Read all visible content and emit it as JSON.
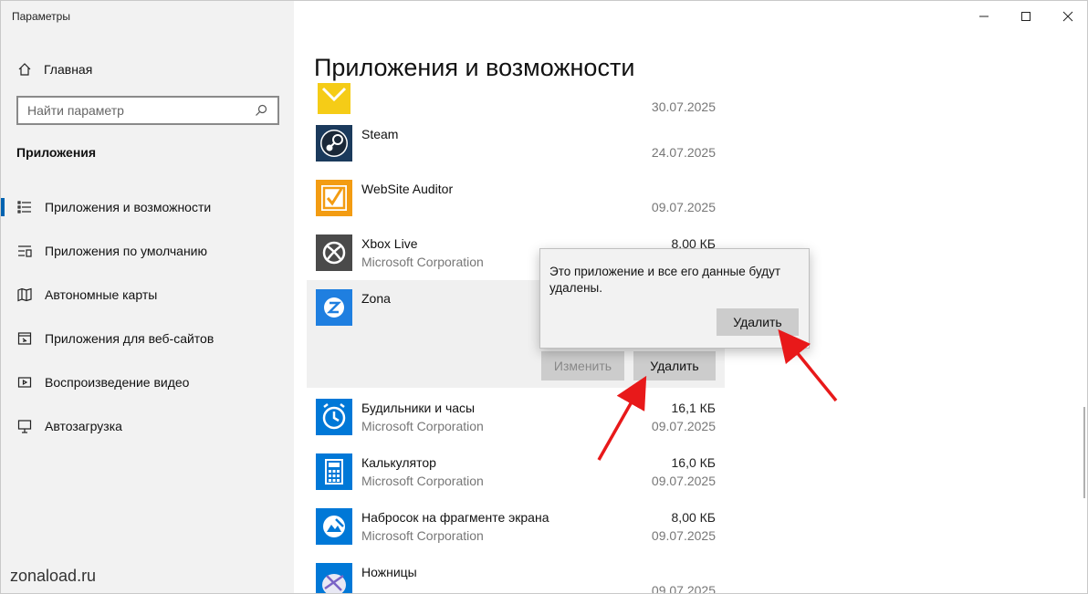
{
  "window": {
    "title": "Параметры",
    "controls": {
      "minimize": "minimize-icon",
      "maximize": "maximize-icon",
      "close": "close-icon"
    }
  },
  "sidebar": {
    "home_label": "Главная",
    "search_placeholder": "Найти параметр",
    "section_title": "Приложения",
    "items": [
      {
        "label": "Приложения и возможности",
        "icon": "apps-features-icon",
        "active": true
      },
      {
        "label": "Приложения по умолчанию",
        "icon": "default-apps-icon",
        "active": false
      },
      {
        "label": "Автономные карты",
        "icon": "offline-maps-icon",
        "active": false
      },
      {
        "label": "Приложения для веб-сайтов",
        "icon": "apps-websites-icon",
        "active": false
      },
      {
        "label": "Воспроизведение видео",
        "icon": "video-playback-icon",
        "active": false
      },
      {
        "label": "Автозагрузка",
        "icon": "startup-icon",
        "active": false
      }
    ],
    "accent_color": "#0063b1"
  },
  "watermark": "zonaload.ru",
  "main": {
    "title": "Приложения и возможности",
    "apps": [
      {
        "name": "",
        "publisher": "",
        "size": "",
        "date": "30.07.2025",
        "icon": "yellow-app-icon"
      },
      {
        "name": "Steam",
        "publisher": "",
        "size": "",
        "date": "24.07.2025",
        "icon": "steam-icon"
      },
      {
        "name": "WebSite Auditor",
        "publisher": "",
        "size": "",
        "date": "09.07.2025",
        "icon": "website-auditor-icon"
      },
      {
        "name": "Xbox Live",
        "publisher": "Microsoft Corporation",
        "size": "8,00 КБ",
        "date": "",
        "icon": "xbox-icon"
      },
      {
        "name": "Zona",
        "publisher": "",
        "size": "",
        "date": "",
        "icon": "zona-icon",
        "expanded": true
      },
      {
        "name": "Будильники и часы",
        "publisher": "Microsoft Corporation",
        "size": "16,1 КБ",
        "date": "09.07.2025",
        "icon": "alarm-clock-icon"
      },
      {
        "name": "Калькулятор",
        "publisher": "Microsoft Corporation",
        "size": "16,0 КБ",
        "date": "09.07.2025",
        "icon": "calculator-icon"
      },
      {
        "name": "Набросок на фрагменте экрана",
        "publisher": "Microsoft Corporation",
        "size": "8,00 КБ",
        "date": "09.07.2025",
        "icon": "snip-sketch-icon"
      },
      {
        "name": "Ножницы",
        "publisher": "",
        "size": "",
        "date": "09.07.2025",
        "icon": "scissors-icon"
      }
    ],
    "buttons": {
      "modify": "Изменить",
      "uninstall": "Удалить"
    }
  },
  "flyout": {
    "text": "Это приложение и все его данные будут удалены.",
    "confirm_label": "Удалить"
  },
  "annotation_color": "#e8191a"
}
